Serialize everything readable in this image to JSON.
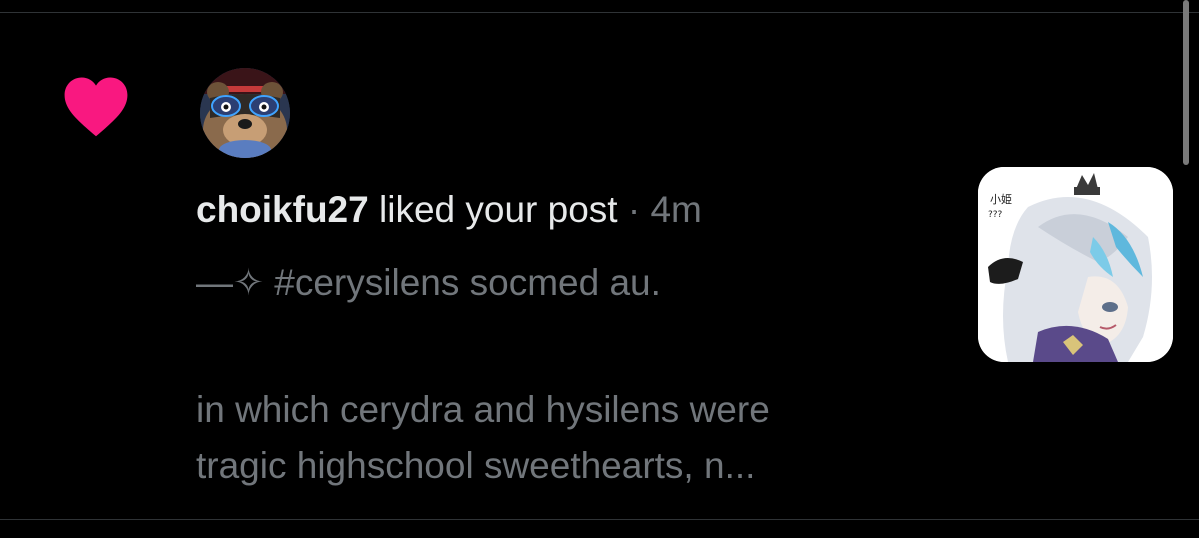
{
  "notification": {
    "icon": "heart-icon",
    "heart_color": "#f91880",
    "username": "choikfu27",
    "action": "liked your post",
    "separator": "·",
    "time": "4m",
    "post_preview": {
      "line1": "—✧ #cerysilens socmed au.",
      "line2": "in which cerydra and hysilens were",
      "line3": "tragic highschool sweethearts, n..."
    }
  },
  "thumbnail_lettering": {
    "line1": "小姫",
    "line2": "???"
  }
}
